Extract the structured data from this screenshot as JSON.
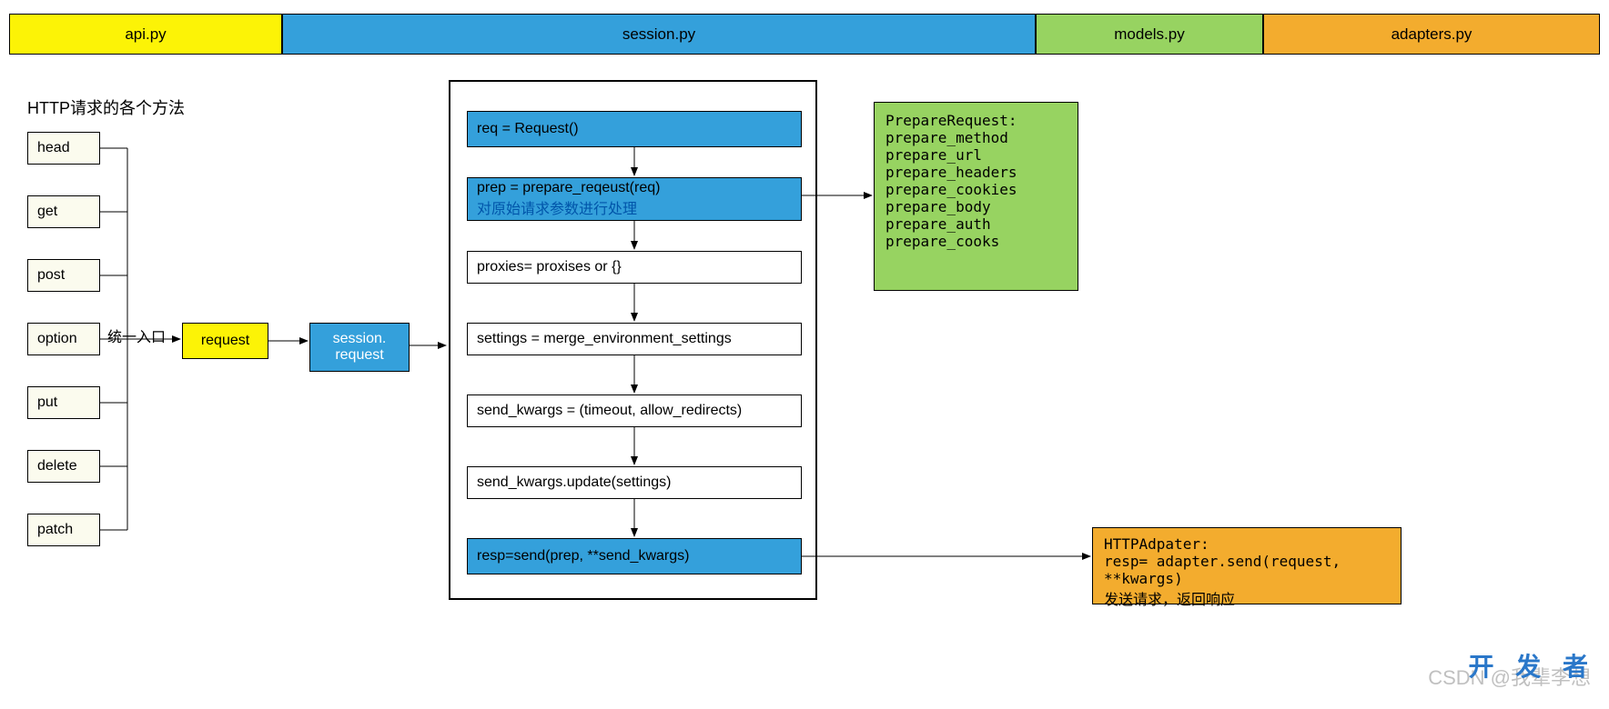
{
  "header": {
    "api": "api.py",
    "session": "session.py",
    "models": "models.py",
    "adapters": "adapters.py"
  },
  "section_title": "HTTP请求的各个方法",
  "methods": [
    "head",
    "get",
    "post",
    "option",
    "put",
    "delete",
    "patch"
  ],
  "arrow_label": "统一入口",
  "request_box": "request",
  "session_request": {
    "l1": "session.",
    "l2": "request"
  },
  "flow": [
    "req = Request()",
    "",
    "proxies= proxises or {}",
    "settings = merge_environment_settings",
    "send_kwargs = (timeout, allow_redirects)",
    "send_kwargs.update(settings)",
    "resp=send(prep, **send_kwargs)"
  ],
  "flow_prep": {
    "l1": "prep = prepare_reqeust(req)",
    "l2": "对原始请求参数进行处理"
  },
  "prepare_box": {
    "title": "PrepareRequest:",
    "items": [
      "prepare_method",
      "prepare_url",
      "prepare_headers",
      "prepare_cookies",
      "prepare_body",
      "prepare_auth",
      "prepare_cooks"
    ]
  },
  "adapter_box": {
    "title": "HTTPAdpater:",
    "line": "resp= adapter.send(request, **kwargs)",
    "note": "发送请求，返回响应"
  },
  "watermark1": "CSDN @我辈李想",
  "watermark2": "开 发 者"
}
